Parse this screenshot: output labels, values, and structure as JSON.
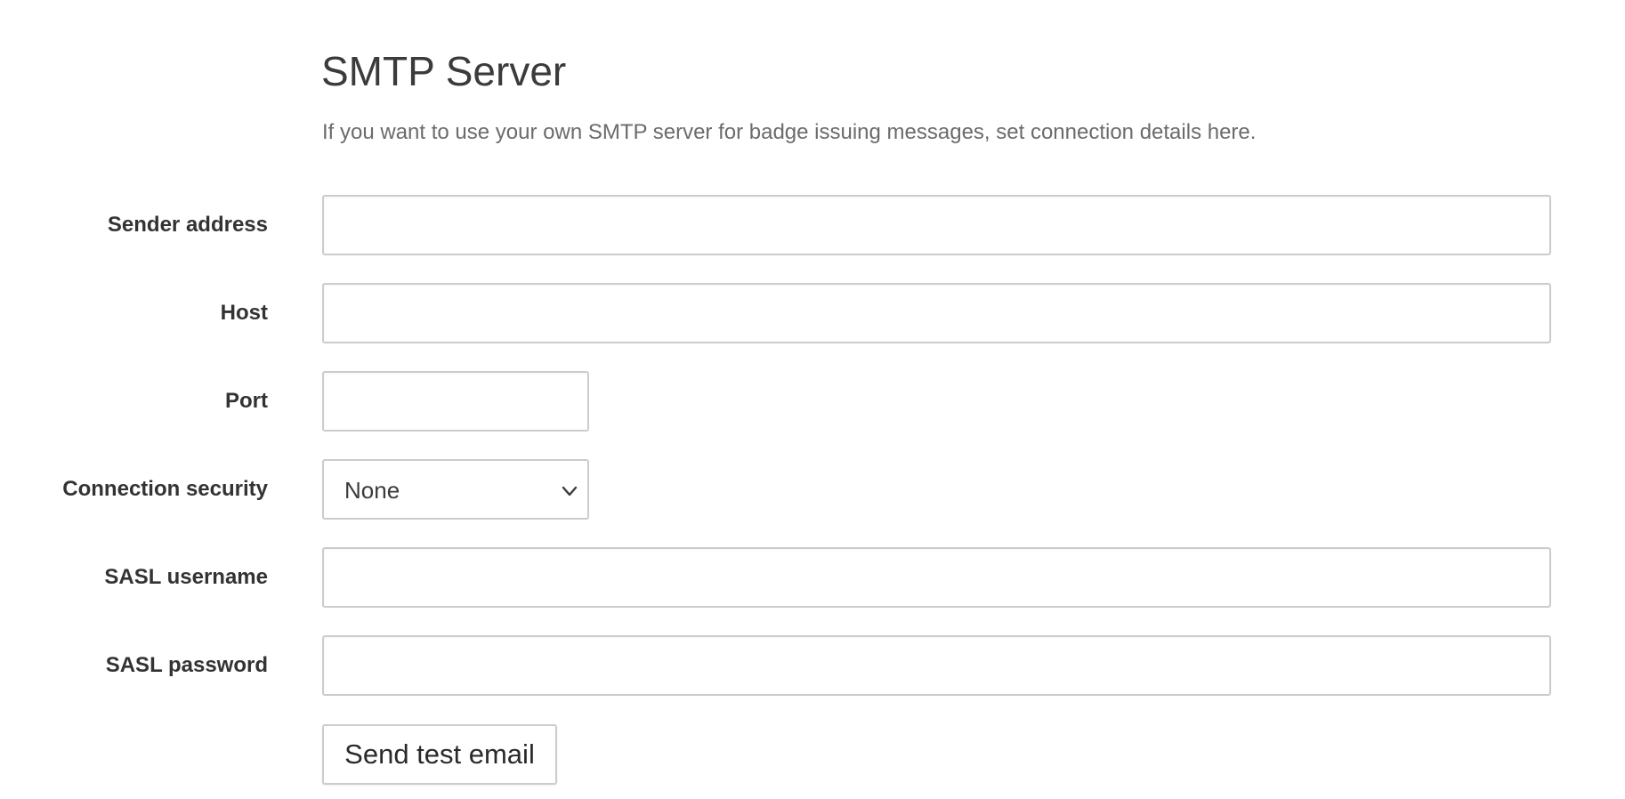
{
  "section": {
    "title": "SMTP Server",
    "description": "If you want to use your own SMTP server for badge issuing messages, set connection details here."
  },
  "fields": {
    "sender_address": {
      "label": "Sender address",
      "value": ""
    },
    "host": {
      "label": "Host",
      "value": ""
    },
    "port": {
      "label": "Port",
      "value": ""
    },
    "connection_security": {
      "label": "Connection security",
      "selected": "None",
      "icon": "chevron-down-icon"
    },
    "sasl_username": {
      "label": "SASL username",
      "value": ""
    },
    "sasl_password": {
      "label": "SASL password",
      "value": ""
    }
  },
  "actions": {
    "send_test_label": "Send test email"
  },
  "colors": {
    "border": "#cccccc",
    "title": "#3b3b3b",
    "description": "#6b6b6b",
    "label": "#333333"
  }
}
